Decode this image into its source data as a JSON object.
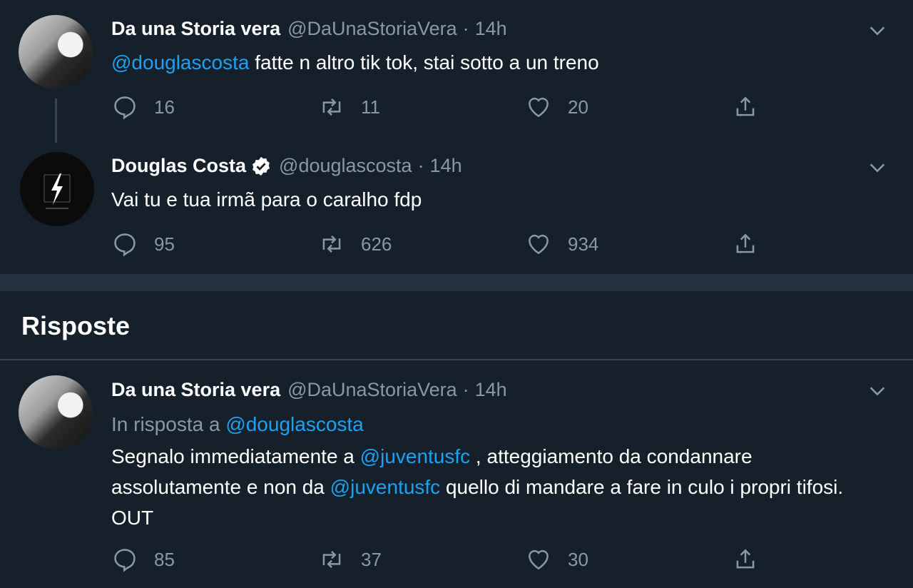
{
  "tweets": [
    {
      "name": "Da una Storia vera",
      "handle": "@DaUnaStoriaVera",
      "time": "14h",
      "mention": "@douglascosta",
      "text": " fatte n altro tik tok, stai sotto a un treno",
      "replies": "16",
      "retweets": "11",
      "likes": "20"
    },
    {
      "name": "Douglas Costa",
      "handle": "@douglascosta",
      "time": "14h",
      "text": "Vai tu e tua irmã para o caralho fdp",
      "replies": "95",
      "retweets": "626",
      "likes": "934"
    }
  ],
  "section": {
    "title": "Risposte"
  },
  "reply": {
    "name": "Da una Storia vera",
    "handle": "@DaUnaStoriaVera",
    "time": "14h",
    "reply_prefix": "In risposta a ",
    "reply_mention": "@douglascosta",
    "text_part1": "Segnalo immediatamente a ",
    "mention1": "@juventusfc",
    "text_part2": " , atteggiamento da condannare assolutamente e non da ",
    "mention2": "@juventusfc",
    "text_part3": "  quello di mandare a fare in culo i propri tifosi. OUT",
    "replies": "85",
    "retweets": "37",
    "likes": "30"
  },
  "icons": {
    "reply": "reply-icon",
    "retweet": "retweet-icon",
    "like": "heart-icon",
    "share": "share-icon",
    "menu": "chevron-down-icon",
    "verified": "verified-badge-icon"
  },
  "colors": {
    "background": "#15202b",
    "accent": "#1da1f2",
    "secondary_text": "#8899a6"
  }
}
